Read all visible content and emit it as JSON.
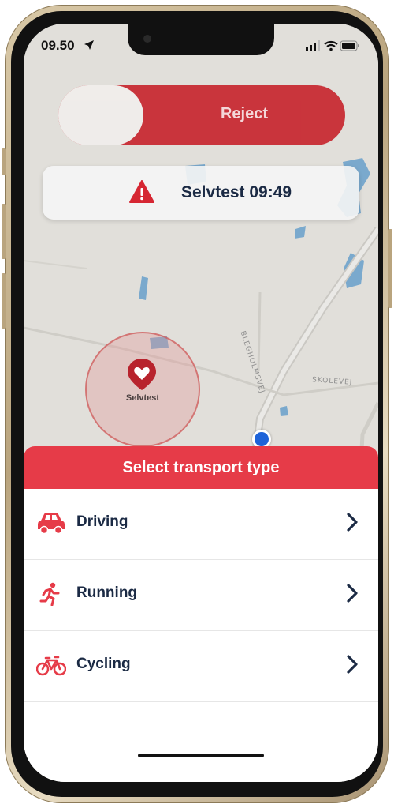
{
  "status_bar": {
    "time": "09.50"
  },
  "reject_slider": {
    "label": "Reject"
  },
  "alert_banner": {
    "text": "Selvtest 09:49"
  },
  "map": {
    "geofence_label": "Selvtest",
    "streets": [
      "BLEGHOLMSVEJ",
      "SKOLEVEJ"
    ]
  },
  "sheet": {
    "title": "Select transport type",
    "options": [
      {
        "label": "Driving",
        "icon": "car-icon"
      },
      {
        "label": "Running",
        "icon": "running-icon"
      },
      {
        "label": "Cycling",
        "icon": "bicycle-icon"
      }
    ]
  },
  "colors": {
    "accent_red": "#e63b48",
    "slider_red": "#c7262f",
    "text_navy": "#1b2a44",
    "location_blue": "#1e63d8"
  }
}
